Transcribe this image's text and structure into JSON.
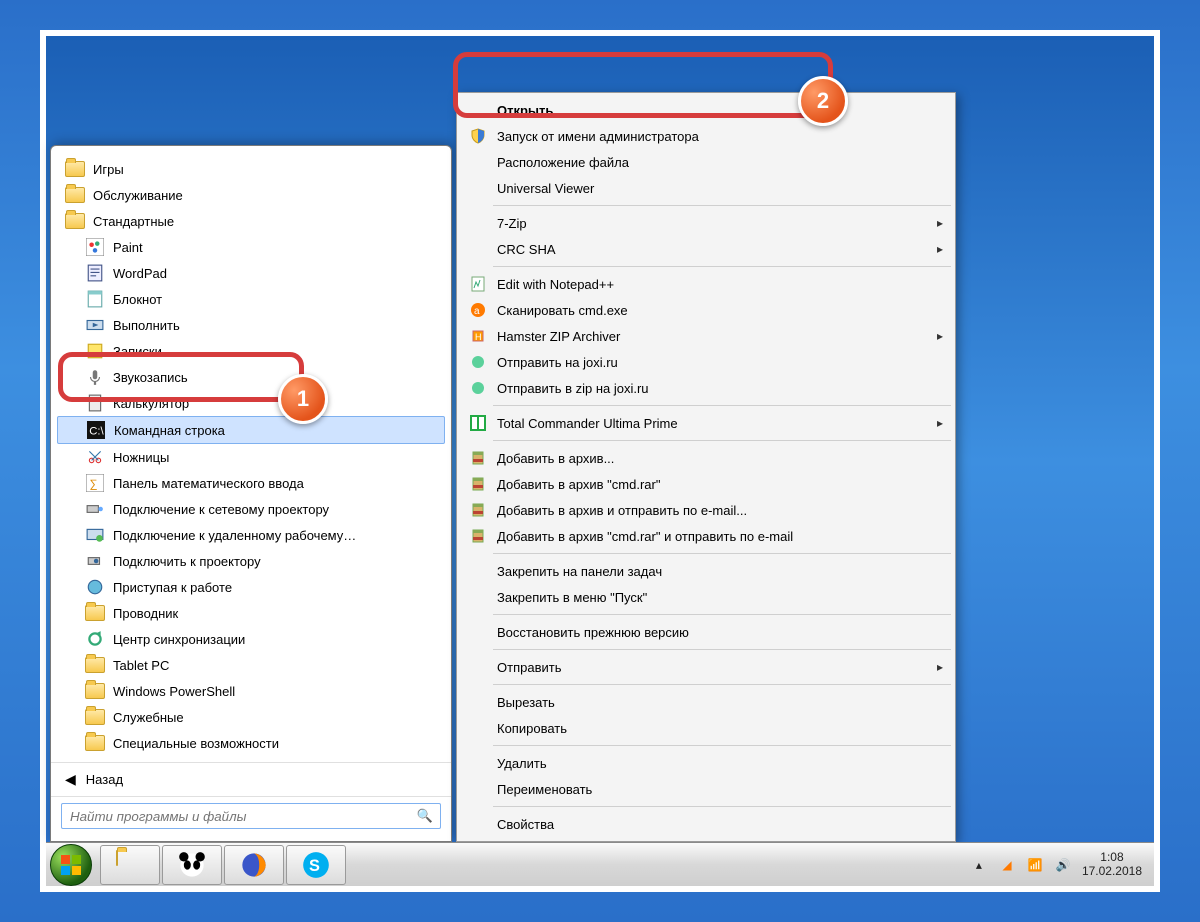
{
  "desktop": {},
  "start_menu": {
    "folders_top": [
      {
        "label": "Игры"
      },
      {
        "label": "Обслуживание"
      },
      {
        "label": "Стандартные"
      }
    ],
    "standard_items": [
      {
        "label": "Paint",
        "icon": "paint"
      },
      {
        "label": "WordPad",
        "icon": "wordpad"
      },
      {
        "label": "Блокнот",
        "icon": "notepad"
      },
      {
        "label": "Выполнить",
        "icon": "run"
      },
      {
        "label": "Записки",
        "icon": "sticky"
      },
      {
        "label": "Звукозапись",
        "icon": "mic"
      },
      {
        "label": "Калькулятор",
        "icon": "calc"
      },
      {
        "label": "Командная строка",
        "icon": "cmd",
        "selected": true
      },
      {
        "label": "Ножницы",
        "icon": "snip"
      },
      {
        "label": "Панель математического ввода",
        "icon": "math"
      },
      {
        "label": "Подключение к сетевому проектору",
        "icon": "netproj"
      },
      {
        "label": "Подключение к удаленному рабочему…",
        "icon": "rdp"
      },
      {
        "label": "Подключить к проектору",
        "icon": "proj"
      },
      {
        "label": "Приступая к работе",
        "icon": "welcome"
      },
      {
        "label": "Проводник",
        "icon": "explorer"
      },
      {
        "label": "Центр синхронизации",
        "icon": "sync"
      }
    ],
    "sub_folders": [
      {
        "label": "Tablet PC"
      },
      {
        "label": "Windows PowerShell"
      },
      {
        "label": "Служебные"
      },
      {
        "label": "Специальные возможности"
      }
    ],
    "back_label": "Назад",
    "search_placeholder": "Найти программы и файлы"
  },
  "context_menu": {
    "groups": [
      [
        {
          "label": "Открыть",
          "default": true
        },
        {
          "label": "Запуск от имени администратора",
          "icon": "shield"
        },
        {
          "label": "Расположение файла"
        },
        {
          "label": "Universal Viewer"
        }
      ],
      [
        {
          "label": "7-Zip",
          "sub": true
        },
        {
          "label": "CRC SHA",
          "sub": true
        }
      ],
      [
        {
          "label": "Edit with Notepad++",
          "icon": "npp"
        },
        {
          "label": "Сканировать cmd.exe",
          "icon": "avast"
        },
        {
          "label": "Hamster ZIP Archiver",
          "icon": "hamster",
          "sub": true
        },
        {
          "label": "Отправить на joxi.ru",
          "icon": "joxi"
        },
        {
          "label": "Отправить в zip на joxi.ru",
          "icon": "joxi"
        }
      ],
      [
        {
          "label": "Total Commander Ultima Prime",
          "icon": "tc",
          "sub": true
        }
      ],
      [
        {
          "label": "Добавить в архив...",
          "icon": "rar"
        },
        {
          "label": "Добавить в архив \"cmd.rar\"",
          "icon": "rar"
        },
        {
          "label": "Добавить в архив и отправить по e-mail...",
          "icon": "rar"
        },
        {
          "label": "Добавить в архив \"cmd.rar\" и отправить по e-mail",
          "icon": "rar"
        }
      ],
      [
        {
          "label": "Закрепить на панели задач"
        },
        {
          "label": "Закрепить в меню \"Пуск\""
        }
      ],
      [
        {
          "label": "Восстановить прежнюю версию"
        }
      ],
      [
        {
          "label": "Отправить",
          "sub": true
        }
      ],
      [
        {
          "label": "Вырезать"
        },
        {
          "label": "Копировать"
        }
      ],
      [
        {
          "label": "Удалить"
        },
        {
          "label": "Переименовать"
        }
      ],
      [
        {
          "label": "Свойства"
        }
      ]
    ]
  },
  "taskbar": {
    "time": "1:08",
    "date": "17.02.2018"
  },
  "annotations": {
    "badge1": "1",
    "badge2": "2"
  }
}
